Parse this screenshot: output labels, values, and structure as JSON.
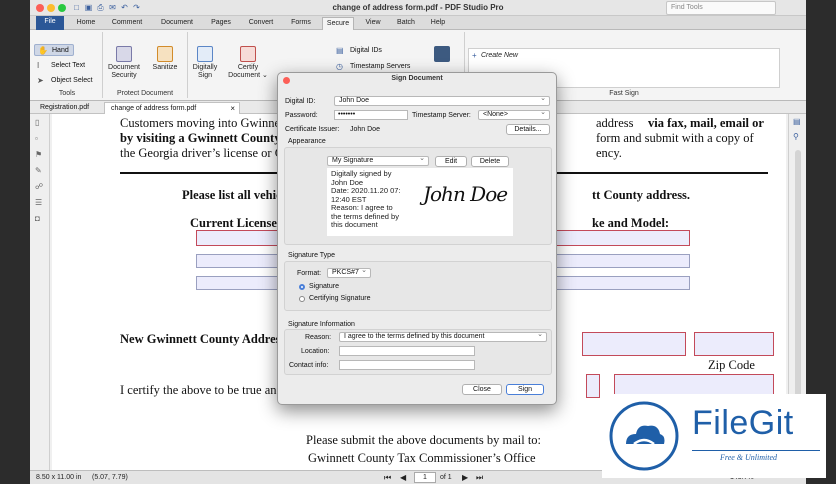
{
  "window": {
    "title": "change of address form.pdf - PDF Studio Pro",
    "find_tools_placeholder": "Find Tools"
  },
  "menu_tabs": [
    "File",
    "Home",
    "Comment",
    "Document",
    "Pages",
    "Convert",
    "Forms",
    "Secure",
    "View",
    "Batch",
    "Help"
  ],
  "active_tab": "Secure",
  "ribbon": {
    "tools": {
      "hand": "Hand",
      "select_text": "Select Text",
      "object_select": "Object Select",
      "label": "Tools"
    },
    "protect": {
      "doc_security_1": "Document",
      "doc_security_2": "Security",
      "sanitize": "Sanitize",
      "label": "Protect Document"
    },
    "sign": {
      "digitally_1": "Digitally",
      "digitally_2": "Sign",
      "certify_1": "Certify",
      "certify_2": "Document ⌄"
    },
    "secure2": {
      "digital_ids": "Digital IDs",
      "timestamp_servers": "Timestamp Servers"
    },
    "fast_sign": {
      "create_new": "Create New",
      "label": "Fast Sign"
    }
  },
  "doc_tabs": [
    "Registration.pdf",
    "change of address form.pdf"
  ],
  "document": {
    "para1_a": "Customers moving into Gwinnett C",
    "para1_b": "address",
    "para1_c": "via fax, mail, email or",
    "para2_a": "by visiting a Gwinnett County ta",
    "para2_b": "form and submit with a copy of",
    "para3_a": "the Georgia driver’s license or Geo",
    "para3_b": "ency.",
    "heading1_a": "Please list all vehicl",
    "heading1_b": "tt County address.",
    "heading2_a": "Current License P",
    "heading2_b": "ke and Model:",
    "new_address": "New Gwinnett County Addres",
    "zip_code": "Zip Code",
    "certify": "I certify the above to be true and",
    "da": "Da",
    "submit_line1": "Please submit the above documents by mail to:",
    "submit_line2": "Gwinnett County Tax Commissioner’s Office"
  },
  "dialog": {
    "title": "Sign Document",
    "digital_id_label": "Digital ID:",
    "digital_id_value": "John Doe",
    "password_label": "Password:",
    "password_value": "•••••••",
    "timestamp_label": "Timestamp Server:",
    "timestamp_value": "<None>",
    "cert_issuer_label": "Certificate Issuer:",
    "cert_issuer_value": "John Doe",
    "details_button": "Details...",
    "appearance_label": "Appearance",
    "appearance_select": "My Signature",
    "edit_button": "Edit",
    "delete_button": "Delete",
    "preview_text": [
      "Digitally signed by",
      "John Doe",
      "Date: 2020.11.20 07:",
      "12:40 EST",
      "Reason: I agree to",
      "the terms defined by",
      "this document"
    ],
    "signature_script": "John Doe",
    "sig_type_label": "Signature Type",
    "format_label": "Format:",
    "format_value": "PKCS#7",
    "radio_signature": "Signature",
    "radio_certifying": "Certifying Signature",
    "sig_info_label": "Signature Information",
    "reason_label": "Reason:",
    "reason_value": "I agree to the terms defined by this document",
    "location_label": "Location:",
    "contact_label": "Contact info:",
    "close_button": "Close",
    "sign_button": "Sign"
  },
  "status": {
    "page_size": "8.50 x 11.00 in",
    "coords": "(5.07, 7.79)",
    "page_number": "1",
    "page_of": "of 1",
    "zoom": "143.7%"
  },
  "watermark": {
    "brand": "FileGit",
    "tagline": "Free & Unlimited"
  },
  "colors": {
    "file_tab": "#2b5797",
    "field_border": "#c34a5a",
    "field_fill": "#ececfc",
    "sign_button_border": "#4a7fd8",
    "brand": "#1f5fa8"
  }
}
